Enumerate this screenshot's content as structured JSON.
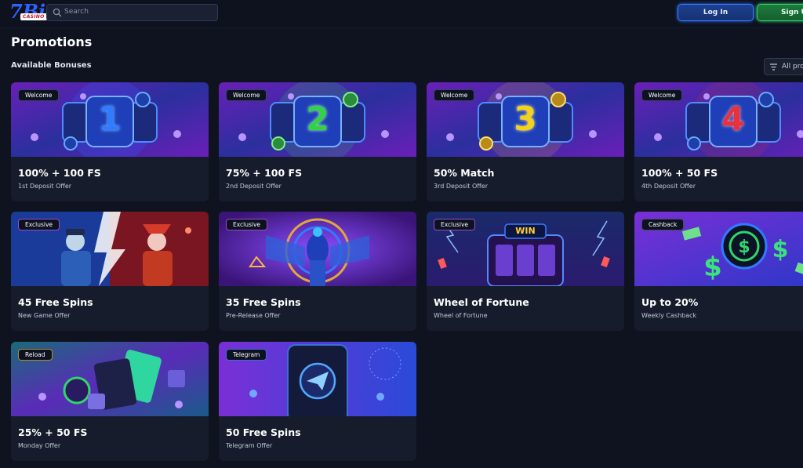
{
  "header": {
    "logo_text": "7Bit Casino",
    "search_placeholder": "Search",
    "login_label": "Log In",
    "signup_label": "Sign Up"
  },
  "page": {
    "title": "Promotions",
    "section_title": "Available Bonuses",
    "filter_label": "All promotions"
  },
  "promotions": [
    {
      "badge": "Welcome",
      "title": "100% + 100 FS",
      "subtitle": "1st Deposit Offer",
      "accent": "#2f7cff",
      "numeral": "1"
    },
    {
      "badge": "Welcome",
      "title": "75% + 100 FS",
      "subtitle": "2nd Deposit Offer",
      "accent": "#35d04a",
      "numeral": "2"
    },
    {
      "badge": "Welcome",
      "title": "50% Match",
      "subtitle": "3rd Deposit Offer",
      "accent": "#f3d21c",
      "numeral": "3"
    },
    {
      "badge": "Welcome",
      "title": "100% + 50 FS",
      "subtitle": "4th Deposit Offer",
      "accent": "#e8313f",
      "numeral": "4"
    },
    {
      "badge": "Exclusive",
      "title": "45 Free Spins",
      "subtitle": "New Game Offer",
      "accent": "#c0392b"
    },
    {
      "badge": "Exclusive",
      "title": "35 Free Spins",
      "subtitle": "Pre-Release Offer",
      "accent": "#7b3fd0"
    },
    {
      "badge": "Exclusive",
      "title": "Wheel of Fortune",
      "subtitle": "Wheel of Fortune",
      "accent": "#2f6cff",
      "sign": "WIN"
    },
    {
      "badge": "Cashback",
      "title": "Up to 20%",
      "subtitle": "Weekly Cashback",
      "accent": "#2fd66a"
    },
    {
      "badge": "Reload",
      "title": "25% + 50 FS",
      "subtitle": "Monday Offer",
      "accent": "#2fd6a0"
    },
    {
      "badge": "Telegram",
      "title": "50 Free Spins",
      "subtitle": "Telegram Offer",
      "accent": "#2f8cff"
    }
  ]
}
